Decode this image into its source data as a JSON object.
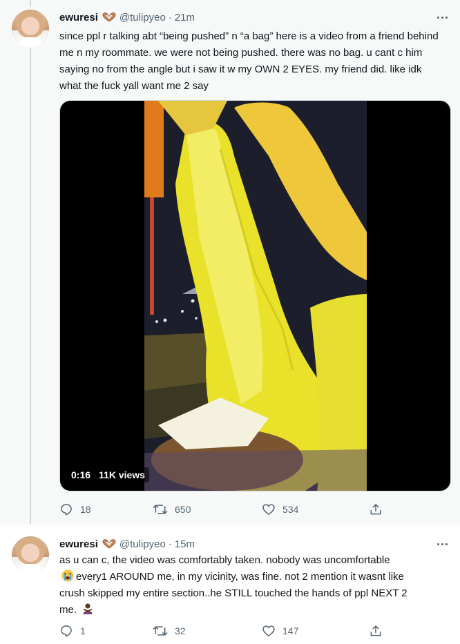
{
  "tweets": [
    {
      "name": "ewuresi",
      "handle": "@tulipyeo",
      "separator": "·",
      "time": "21m",
      "name_badge_icon": "heart-hands-icon",
      "text": "since ppl r talking abt “being pushed” n “a bag” here is a video from a friend behind me n my roommate. we were not being pushed. there was no bag. u cant c him saying no from the angle but i saw it w my OWN 2 EYES. my friend did. like idk what the fuck yall want me 2 say",
      "video": {
        "duration": "0:16",
        "views": "11K views"
      },
      "actions": {
        "replies": "18",
        "retweets": "650",
        "likes": "534"
      }
    },
    {
      "name": "ewuresi",
      "handle": "@tulipyeo",
      "separator": "·",
      "time": "15m",
      "name_badge_icon": "heart-hands-icon",
      "text_line1": "as u can c, the video was comfortably taken. nobody was uncomfortable",
      "text_line2": "every1 AROUND me, in my vicinity, was fine. not 2 mention it wasnt like",
      "text_line3": "crush skipped my entire section..he STILL touched the hands of ppl NEXT 2",
      "text_line4": "me.",
      "emojis": [
        "loudly-crying-face-icon",
        "person-gesturing-no-icon"
      ],
      "actions": {
        "replies": "1",
        "retweets": "32",
        "likes": "147"
      }
    }
  ],
  "colors": {
    "text": "#0f1419",
    "muted": "#536471",
    "thread_line": "#cfd9de",
    "highlight_bg": "#f7f9f9"
  }
}
